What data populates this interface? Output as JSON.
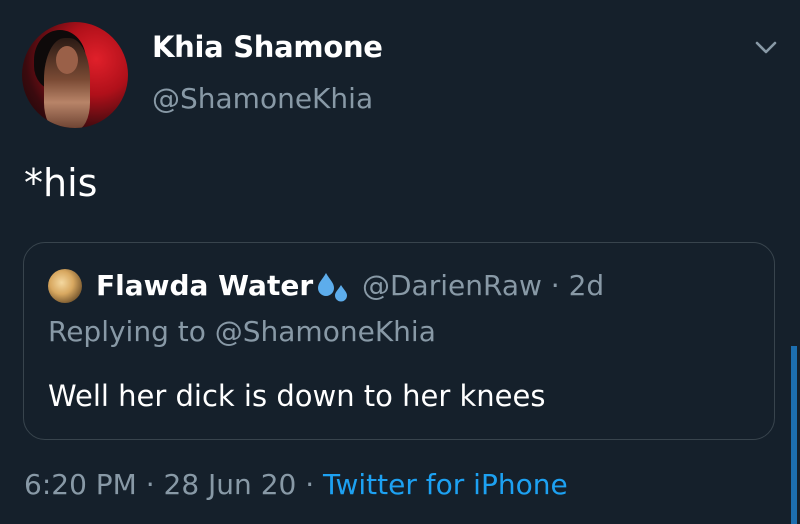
{
  "author": {
    "name": "Khia Shamone",
    "handle": "@ShamoneKhia"
  },
  "tweet": {
    "text": "*his"
  },
  "quoted_tweet": {
    "author_name": "Flawda Water",
    "emoji": "sweat-droplets-icon",
    "handle_and_time": "@DarienRaw · 2d",
    "replying_to": "Replying to @ShamoneKhia",
    "text": "Well her dick is down to her knees"
  },
  "meta": {
    "time_date": "6:20 PM · 28 Jun 20 · ",
    "source": "Twitter for iPhone"
  },
  "colors": {
    "background": "#15202b",
    "secondary_text": "#8899a6",
    "accent": "#1da1f2",
    "border": "#38444d"
  }
}
